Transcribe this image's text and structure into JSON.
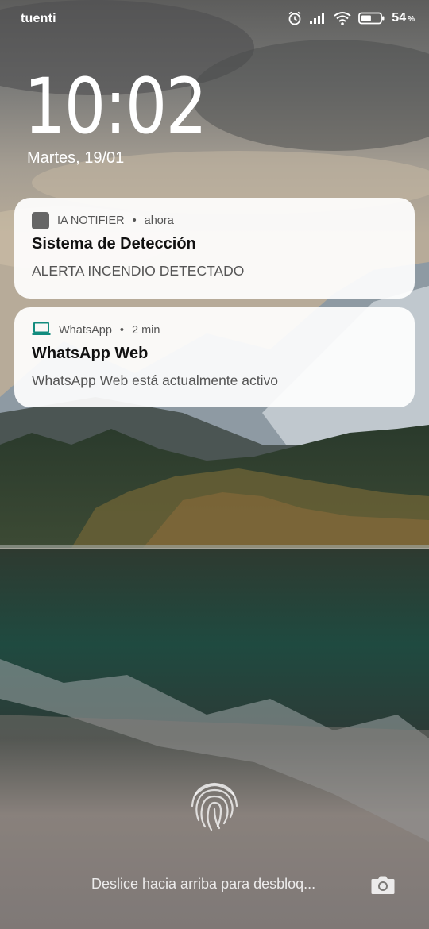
{
  "status_bar": {
    "carrier": "tuenti",
    "battery_percent": "54",
    "battery_unit": "%",
    "battery_level": 0.54,
    "icons": [
      "alarm-icon",
      "signal-icon",
      "wifi-icon",
      "battery-icon"
    ]
  },
  "lockscreen": {
    "time": "10:02",
    "date": "Martes, 19/01"
  },
  "notifications": [
    {
      "app": "IA NOTIFIER",
      "separator": "•",
      "time": "ahora",
      "title": "Sistema de Detección",
      "body": "ALERTA INCENDIO DETECTADO",
      "icon": "app-square-icon"
    },
    {
      "app": "WhatsApp",
      "separator": "•",
      "time": "2 min",
      "title": "WhatsApp Web",
      "body": "WhatsApp Web está actualmente activo",
      "icon": "laptop-icon",
      "icon_color": "#128C7E"
    }
  ],
  "bottom": {
    "unlock_hint": "Deslice hacia arriba para desbloq...",
    "icons": [
      "fingerprint-icon",
      "camera-icon"
    ]
  }
}
